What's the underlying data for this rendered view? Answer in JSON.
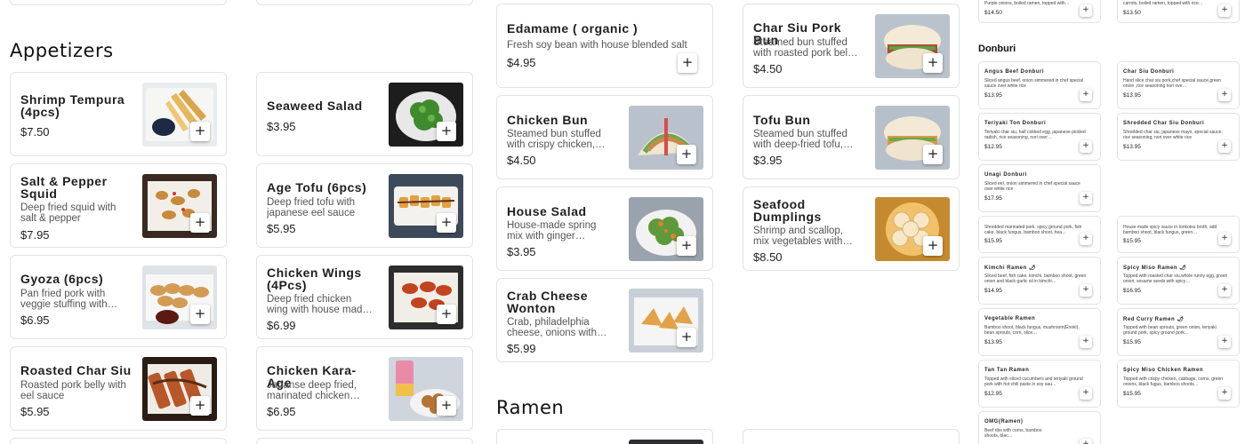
{
  "add_label": "+",
  "sections": {
    "appetizers": "Appetizers",
    "ramen": "Ramen",
    "donburi": "Donburi"
  },
  "col1": [
    {
      "name": "Shrimp Tempura (4pcs)",
      "desc": "",
      "price": "$7.50",
      "icon": "shrimp-tempura-photo"
    },
    {
      "name": "Salt & Pepper Squid",
      "desc": "Deep fried squid with salt & pepper",
      "price": "$7.95",
      "icon": "squid-photo"
    },
    {
      "name": "Gyoza (6pcs)",
      "desc": "Pan fried pork with veggie stuffing with…",
      "price": "$6.95",
      "icon": "gyoza-photo"
    },
    {
      "name": "Roasted Char Siu",
      "desc": "Roasted pork belly with eel sauce",
      "price": "$5.95",
      "icon": "char-siu-photo"
    }
  ],
  "col2": [
    {
      "name": "Seaweed Salad",
      "desc": "",
      "price": "$3.95",
      "icon": "seaweed-salad-photo"
    },
    {
      "name": "Age Tofu (6pcs)",
      "desc": "Deep fried tofu with japanese eel sauce a…",
      "price": "$5.95",
      "icon": "age-tofu-photo"
    },
    {
      "name": "Chicken Wings (4Pcs)",
      "desc": "Deep fried chicken wing with house mad…",
      "price": "$6.99",
      "icon": "chicken-wings-photo"
    },
    {
      "name": "Chicken Kara-Age",
      "desc": "Japanse deep fried, marinated chicken…",
      "price": "$6.95",
      "icon": "kara-age-photo"
    }
  ],
  "col3": [
    {
      "name": "Edamame ( organic )",
      "desc": "Fresh soy bean with house blended salt",
      "price": "$4.95"
    },
    {
      "name": "Chicken Bun",
      "desc": "Steamed bun stuffed with crispy chicken,…",
      "price": "$4.50",
      "icon": "chicken-bun-photo"
    },
    {
      "name": "House Salad",
      "desc": "House-made spring mix with ginger…",
      "price": "$3.95",
      "icon": "house-salad-photo"
    },
    {
      "name": "Crab Cheese Wonton",
      "desc": "Crab, philadelphia cheese, onions with…",
      "price": "$5.99",
      "icon": "wonton-photo"
    }
  ],
  "col4": [
    {
      "name": "Char Siu Pork Bun",
      "desc": "Steamed bun stuffed with roasted pork bel…",
      "price": "$4.50",
      "icon": "pork-bun-photo"
    },
    {
      "name": "Tofu Bun",
      "desc": "Steamed bun stuffed with deep-fried tofu,…",
      "price": "$3.95",
      "icon": "tofu-bun-photo"
    },
    {
      "name": "Seafood Dumplings",
      "desc": "Shrimp and scallop, mix vegetables with…",
      "price": "$8.50",
      "icon": "dumplings-photo"
    }
  ],
  "top_small": [
    {
      "desc": "Purple onions, boiled ramen, topped with…",
      "price": "$14.50"
    },
    {
      "desc": "carrots, boiled ramen, topped with rice…",
      "price": "$13.50"
    }
  ],
  "small_left": [
    {
      "name": "Angus Beef Donburi",
      "desc": "Sliced angus beef, onion simmered in chef special sauce over white rice",
      "price": "$13.95"
    },
    {
      "name": "Teriyaki Ton Donburi",
      "desc": "Teriyaki char siu, half cokked egg, japanese pickled radish, rice seasoning, nori over…",
      "price": "$12.95"
    },
    {
      "name": "Unagi Donburi",
      "desc": "Sliced eel, onion simmered in chef special sauce over white rice",
      "price": "$17.95"
    },
    {
      "name": "",
      "desc": "Shredded marinated pork, spicy ground pork, fish cake, black fungus, bamboo shoot, hea…",
      "price": "$15.95"
    },
    {
      "name": "Kimchi Ramen 🌶",
      "desc": "Sliced beef, fish cake, kimchi, bamboo shoot, green onion and black garlic oil in kimchi…",
      "price": "$14.95"
    },
    {
      "name": "Vegetable Ramen",
      "desc": "Bamboo shoot, black fungus, mushroom(Enoki), bean sprouts, corn, slice…",
      "price": "$13.95"
    },
    {
      "name": "Tan Tan Ramen",
      "desc": "Topped with sliced cucumbers and teriyaki ground pork with hot chili paste in soy sau…",
      "price": "$12.95"
    },
    {
      "name": "OMG(Ramen)",
      "desc": "Beef ribs with corns, bamboo shoots, blac…",
      "price": ""
    }
  ],
  "small_right": [
    {
      "name": "Char Siu Donburi",
      "desc": "Hand slice char siu pork,chef special sauce,green onion ,rice seasoning nori ove…",
      "price": "$13.95"
    },
    {
      "name": "Shredded Char Siu Donburi",
      "desc": "Shredded char siu, japanese mayo, special sauce, rice seasoning, nori over white rice",
      "price": "$13.95"
    },
    {
      "name": "",
      "desc": "House made spicy sauce in tonkotsu broth, add bamboo shoot, black fungus, green…",
      "price": "$15.95"
    },
    {
      "name": "Spicy Miso Ramen 🌶",
      "desc": "Topped with roasted char siu,whole runny egg, green onion, sesame seeds with spicy…",
      "price": "$16.95"
    },
    {
      "name": "Red Curry Ramen 🌶",
      "desc": "Topped with bean sprouts, green onion, teriyaki ground pork, spicy ground pork…",
      "price": "$15.95"
    },
    {
      "name": "Spicy Miso Chicken Ramen",
      "desc": "Topped with crispy chicken, cabbage, corns, green onions, black fugus, bamboo shoots…",
      "price": "$15.95"
    }
  ]
}
